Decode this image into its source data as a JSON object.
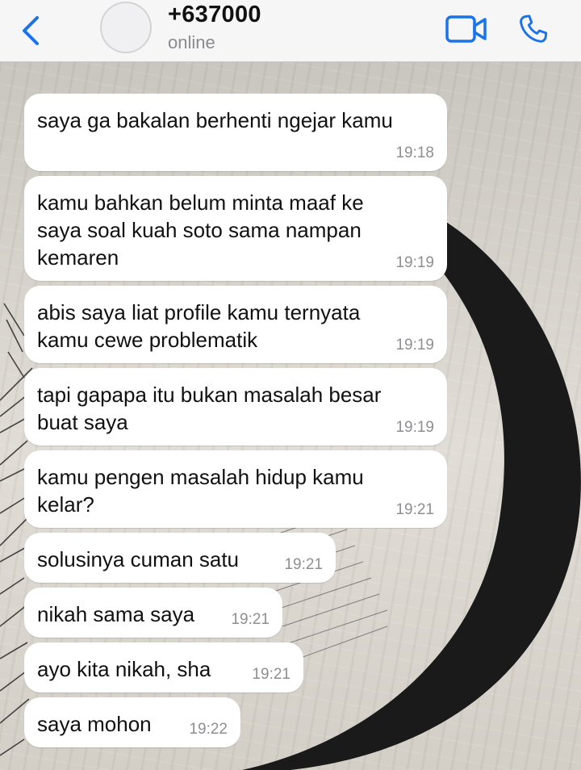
{
  "header": {
    "contact_name": "+637000",
    "status": "online",
    "icons": {
      "back": "chevron-left-icon",
      "video": "video-camera-icon",
      "call": "phone-icon"
    },
    "accent_color": "#1a73e8"
  },
  "messages": [
    {
      "text": "saya ga bakalan berhenti ngejar kamu",
      "time": "19:18"
    },
    {
      "text": "kamu bahkan belum minta maaf ke\nsaya soal kuah soto sama nampan\nkemaren",
      "time": "19:19"
    },
    {
      "text": "abis saya liat profile kamu ternyata\nkamu cewe problematik",
      "time": "19:19"
    },
    {
      "text": "tapi gapapa itu bukan masalah besar\nbuat saya",
      "time": "19:19"
    },
    {
      "text": "kamu pengen masalah hidup kamu\nkelar?",
      "time": "19:21"
    },
    {
      "text": "solusinya cuman satu",
      "time": "19:21"
    },
    {
      "text": "nikah sama saya",
      "time": "19:21"
    },
    {
      "text": "ayo kita nikah, sha",
      "time": "19:21"
    },
    {
      "text": "saya mohon",
      "time": "19:22"
    }
  ]
}
